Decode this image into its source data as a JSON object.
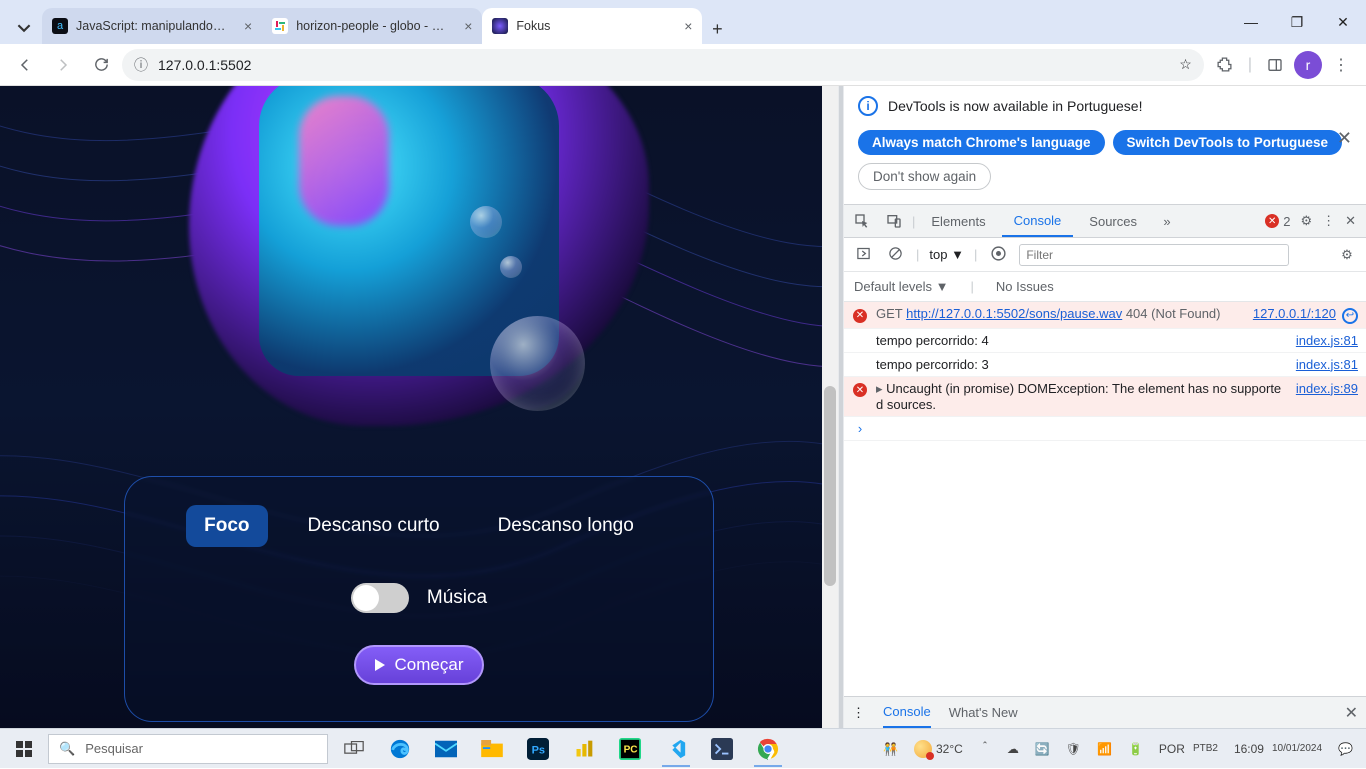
{
  "browser": {
    "tabs": [
      {
        "title": "JavaScript: manipulando eleme",
        "favicon_bg": "#0b0d14",
        "favicon_fg": "#45c1ff"
      },
      {
        "title": "horizon-people - globo - Slack",
        "favicon_bg": "#ffffff",
        "favicon_fg": "#e01e5a"
      },
      {
        "title": "Fokus",
        "favicon_bg": "#10163a",
        "favicon_fg": "#7b5cff"
      }
    ],
    "active_tab": 2,
    "url": "127.0.0.1:5502",
    "avatar_letter": "r"
  },
  "app": {
    "modes": {
      "foco": "Foco",
      "curto": "Descanso curto",
      "longo": "Descanso longo"
    },
    "music_label": "Música",
    "start_label": "Começar"
  },
  "devtools": {
    "banner_text": "DevTools is now available in Portuguese!",
    "pill_match": "Always match Chrome's language",
    "pill_switch": "Switch DevTools to Portuguese",
    "pill_dont": "Don't show again",
    "tab_elements": "Elements",
    "tab_console": "Console",
    "tab_sources": "Sources",
    "error_count": "2",
    "ctx_label": "top",
    "filter_placeholder": "Filter",
    "levels_label": "Default levels",
    "issues_label": "No Issues",
    "rows": {
      "r1_method": "GET ",
      "r1_url": "http://127.0.0.1:5502/sons/pause.wav",
      "r1_status": " 404 (Not Found)",
      "r1_src": "127.0.0.1/:120",
      "r2_msg": "tempo percorrido: 4",
      "r2_src": "index.js:81",
      "r3_msg": "tempo percorrido: 3",
      "r3_src": "index.js:81",
      "r4_msg": "Uncaught (in promise) DOMException: The element has no supported sources.",
      "r4_src": "index.js:89"
    },
    "drawer_console": "Console",
    "drawer_whatsnew": "What's New"
  },
  "taskbar": {
    "search_placeholder": "Pesquisar",
    "temp": "32°C",
    "lang1": "POR",
    "lang2": "PTB2",
    "time": "16:09",
    "date": "10/01/2024"
  }
}
